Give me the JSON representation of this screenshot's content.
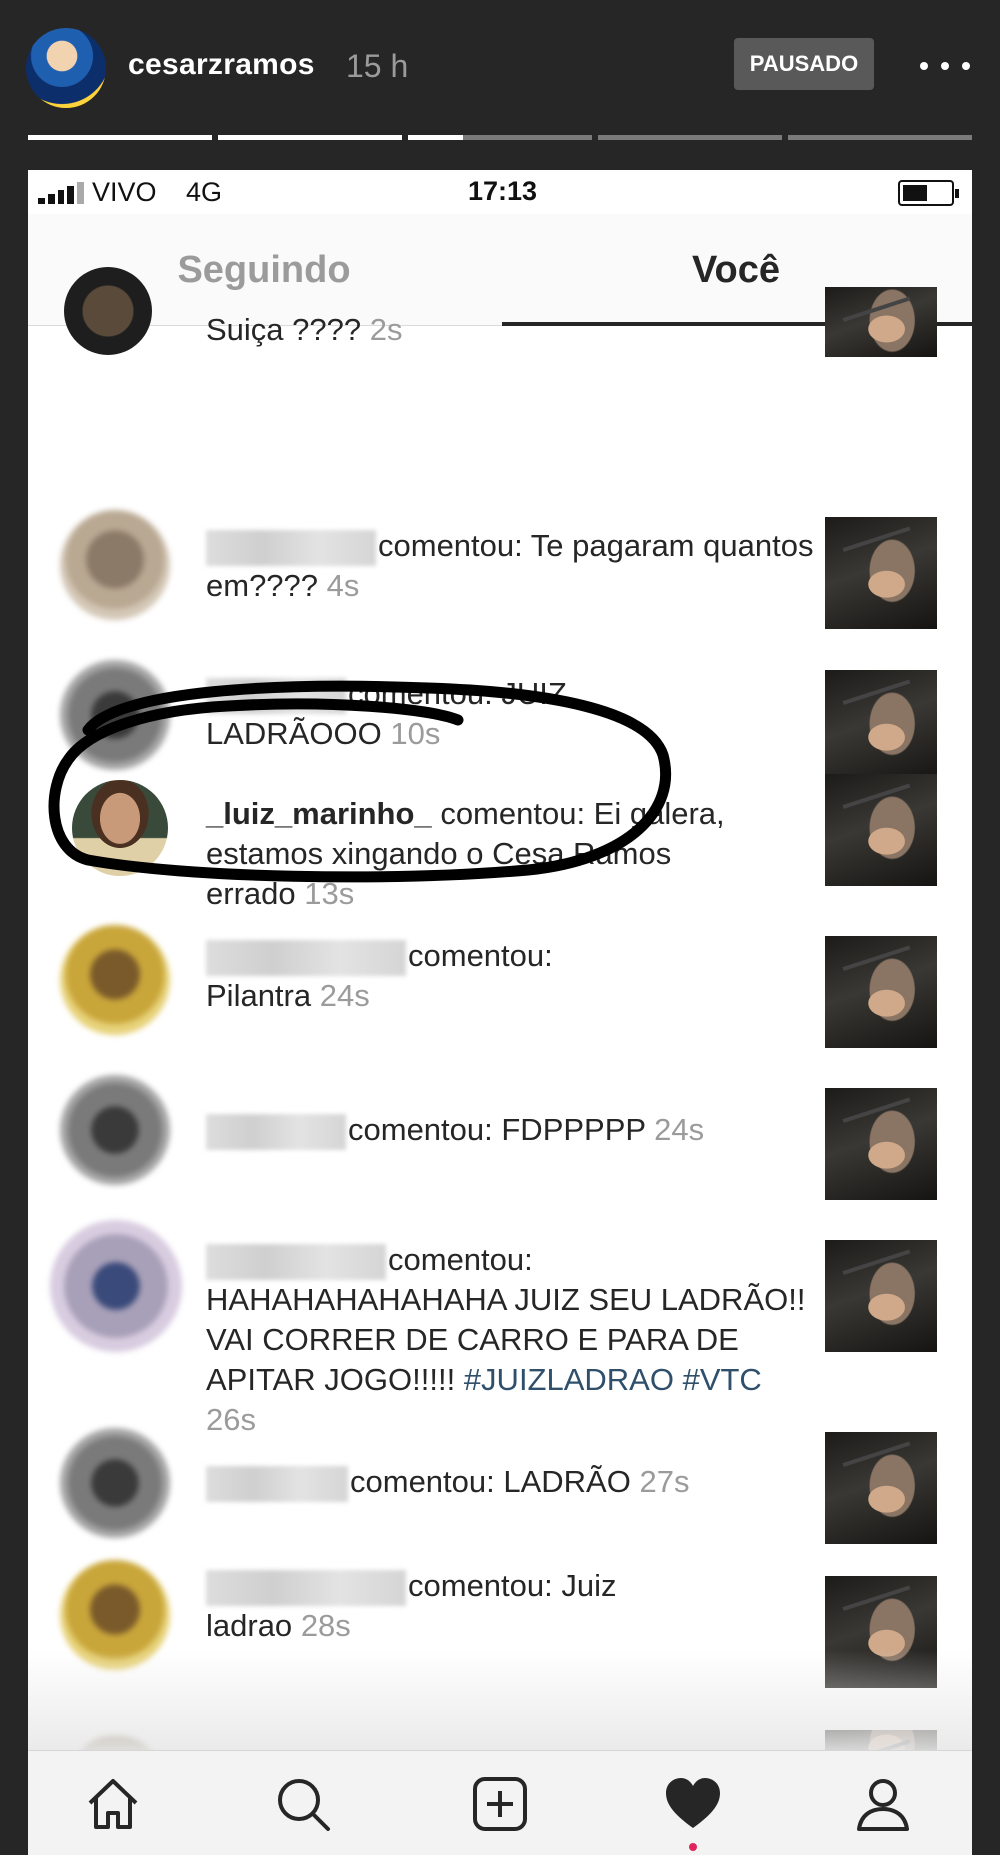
{
  "story": {
    "username": "cesarzramos",
    "time_ago": "15 h",
    "paused_label": "PAUSADO",
    "progress_segments": [
      1,
      1,
      0.3,
      0,
      0
    ]
  },
  "status_bar": {
    "carrier": "VIVO",
    "network": "4G",
    "clock": "17:13"
  },
  "tabs": {
    "following": "Seguindo",
    "you": "Você"
  },
  "activity": [
    {
      "name": "",
      "action": "Suiça ????",
      "time": "2s"
    },
    {
      "name": "",
      "action": "comentou: Te pagaram quantos em????",
      "time": "4s"
    },
    {
      "name": "",
      "action": "comentou: JUIZ LADRÃOOO",
      "time": "10s"
    },
    {
      "name": "_luiz_marinho_",
      "action": "comentou: Ei galera, estamos xingando o Cesa Ramos errado",
      "time": "13s"
    },
    {
      "name": "",
      "action": "comentou: Pilantra",
      "time": "24s"
    },
    {
      "name": "",
      "action": "comentou: FDPPPPP",
      "time": "24s"
    },
    {
      "name": "",
      "action": "comentou: HAHAHAHAHAHAHA JUIZ SEU LADRÃO!! VAI CORRER DE CARRO E PARA DE APITAR JOGO!!!!!",
      "hashtags": "#JUIZLADRAO #VTC",
      "time": "26s"
    },
    {
      "name": "",
      "action": "comentou: LADRÃO",
      "time": "27s"
    },
    {
      "name": "",
      "action": "comentou: Juiz ladrao",
      "time": "28s"
    }
  ],
  "icons": {
    "nav": [
      "home-icon",
      "search-icon",
      "new-post-icon",
      "activity-heart-icon",
      "profile-icon"
    ],
    "active_nav": "activity-heart-icon",
    "notification_dot_color": "#e0245e"
  },
  "colors": {
    "story_bg": "#262626",
    "hashtag": "#2f4f6b",
    "timestamp": "#9b9b9b",
    "annotation_ink": "#000000"
  }
}
